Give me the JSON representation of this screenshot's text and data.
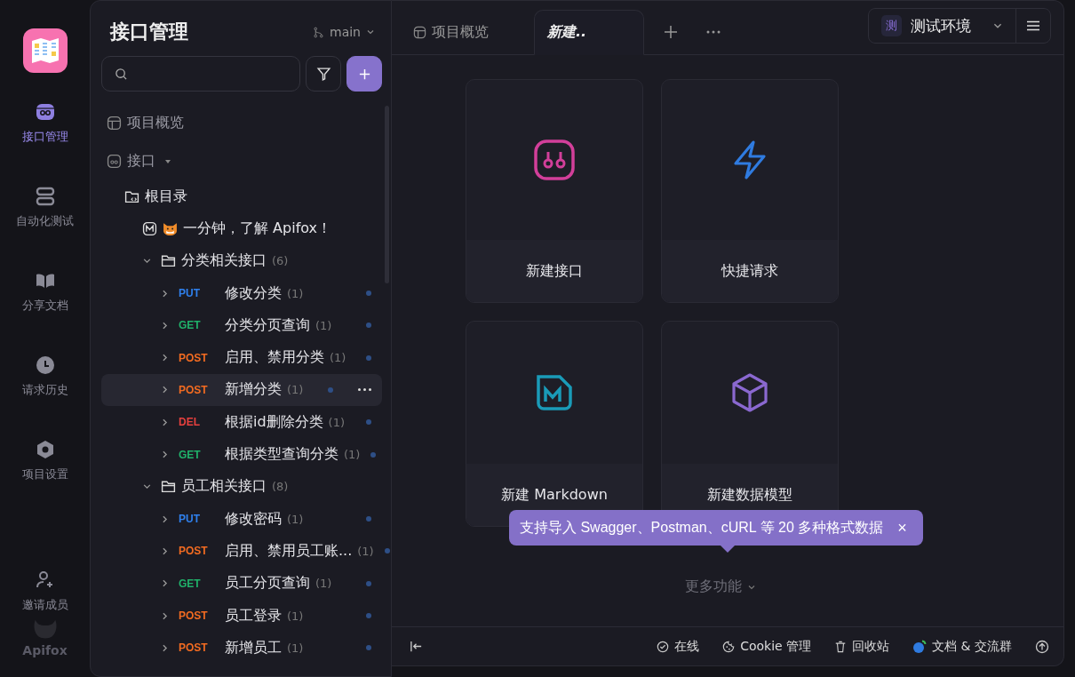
{
  "rail": {
    "items": [
      {
        "kind": "api",
        "label": "接口管理",
        "selected": true
      },
      {
        "kind": "auto",
        "label": "自动化测试",
        "selected": false
      },
      {
        "kind": "share",
        "label": "分享文档",
        "selected": false
      },
      {
        "kind": "history",
        "label": "请求历史",
        "selected": false
      },
      {
        "kind": "settings",
        "label": "项目设置",
        "selected": false
      }
    ],
    "invite": "邀请成员",
    "brand": "Apifox"
  },
  "sidebar": {
    "title": "接口管理",
    "branch": "main",
    "tree": [
      {
        "kind": "overview",
        "label": "项目概览"
      },
      {
        "kind": "api-root",
        "label": "接口",
        "expanded": true,
        "children": [
          {
            "kind": "root-folder",
            "label": "根目录",
            "children": [
              {
                "kind": "doc",
                "label": "一分钟，了解 Apifox！"
              },
              {
                "kind": "folder",
                "label": "分类相关接口",
                "count": "(6)",
                "expanded": true,
                "children": [
                  {
                    "kind": "endpoint",
                    "method": "PUT",
                    "color": "#2f80ed",
                    "label": "修改分类",
                    "count": "(1)",
                    "selected": false
                  },
                  {
                    "kind": "endpoint",
                    "method": "GET",
                    "color": "#20b16a",
                    "label": "分类分页查询",
                    "count": "(1)",
                    "selected": false
                  },
                  {
                    "kind": "endpoint",
                    "method": "POST",
                    "color": "#f26b21",
                    "label": "启用、禁用分类",
                    "count": "(1)",
                    "selected": false
                  },
                  {
                    "kind": "endpoint",
                    "method": "POST",
                    "color": "#f26b21",
                    "label": "新增分类",
                    "count": "(1)",
                    "selected": true
                  },
                  {
                    "kind": "endpoint",
                    "method": "DEL",
                    "color": "#e5403e",
                    "label": "根据id删除分类",
                    "count": "(1)",
                    "selected": false
                  },
                  {
                    "kind": "endpoint",
                    "method": "GET",
                    "color": "#20b16a",
                    "label": "根据类型查询分类",
                    "count": "(1)",
                    "selected": false
                  }
                ]
              },
              {
                "kind": "folder",
                "label": "员工相关接口",
                "count": "(8)",
                "expanded": true,
                "children": [
                  {
                    "kind": "endpoint",
                    "method": "PUT",
                    "color": "#2f80ed",
                    "label": "修改密码",
                    "count": "(1)",
                    "selected": false
                  },
                  {
                    "kind": "endpoint",
                    "method": "POST",
                    "color": "#f26b21",
                    "label": "启用、禁用员工账...",
                    "count": "(1)",
                    "selected": false
                  },
                  {
                    "kind": "endpoint",
                    "method": "GET",
                    "color": "#20b16a",
                    "label": "员工分页查询",
                    "count": "(1)",
                    "selected": false
                  },
                  {
                    "kind": "endpoint",
                    "method": "POST",
                    "color": "#f26b21",
                    "label": "员工登录",
                    "count": "(1)",
                    "selected": false
                  },
                  {
                    "kind": "endpoint",
                    "method": "POST",
                    "color": "#f26b21",
                    "label": "新增员工",
                    "count": "(1)",
                    "selected": false
                  }
                ]
              }
            ]
          }
        ]
      }
    ]
  },
  "tabs": [
    {
      "kind": "overview",
      "label": "项目概览",
      "selected": false
    },
    {
      "kind": "new",
      "label": "新建..",
      "selected": true
    }
  ],
  "environment": {
    "badge": "测",
    "label": "测试环境"
  },
  "cards": [
    {
      "kind": "api",
      "label": "新建接口"
    },
    {
      "kind": "quick",
      "label": "快捷请求"
    },
    {
      "kind": "markdown",
      "label": "新建 Markdown"
    },
    {
      "kind": "model",
      "label": "新建数据模型"
    }
  ],
  "tooltip": {
    "text": "支持导入 Swagger、Postman、cURL 等 20 多种格式数据",
    "close": "×"
  },
  "more": "更多功能",
  "status_bar": [
    {
      "kind": "online",
      "label": "在线"
    },
    {
      "kind": "cookie",
      "label": "Cookie 管理"
    },
    {
      "kind": "trash",
      "label": "回收站"
    },
    {
      "kind": "chat",
      "label": "文档 & 交流群"
    }
  ]
}
